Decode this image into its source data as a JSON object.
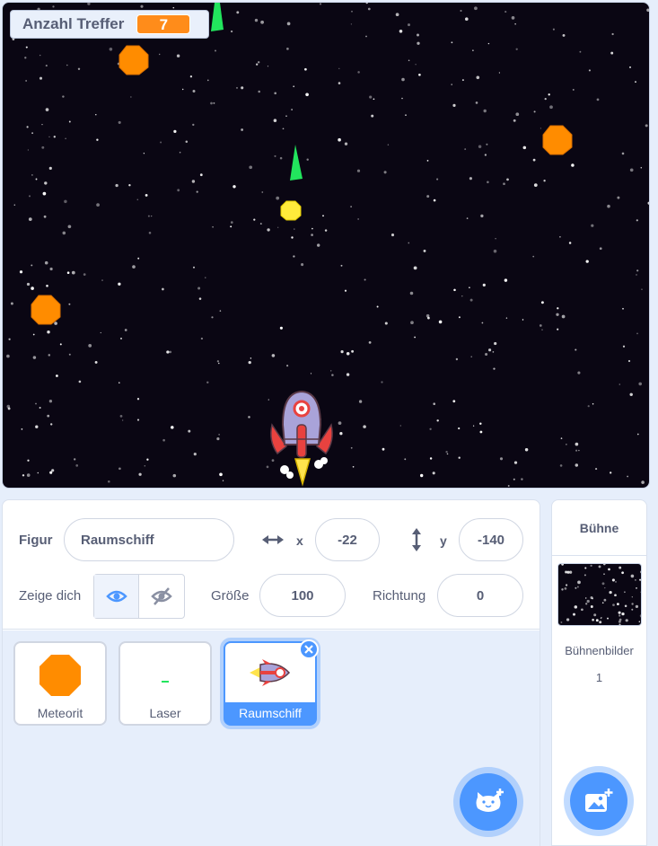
{
  "stage": {
    "monitor": {
      "label": "Anzahl Treffer",
      "value": "7"
    },
    "colors": {
      "background": "#0a0613",
      "meteor": "#ff8c00",
      "laser": "#22e55d",
      "coin": "#ffeb3b"
    }
  },
  "sprite_info": {
    "sprite_label": "Figur",
    "sprite_name": "Raumschiff",
    "x_label": "x",
    "x_value": "-22",
    "y_label": "y",
    "y_value": "-140",
    "show_label": "Zeige dich",
    "size_label": "Größe",
    "size_value": "100",
    "direction_label": "Richtung",
    "direction_value": "0"
  },
  "sprites": [
    {
      "name": "Meteorit",
      "icon": "meteor-icon",
      "selected": false
    },
    {
      "name": "Laser",
      "icon": "laser-icon",
      "selected": false
    },
    {
      "name": "Raumschiff",
      "icon": "rocket-icon",
      "selected": true
    }
  ],
  "stage_panel": {
    "title": "Bühne",
    "backdrops_label": "Bühnenbilder",
    "backdrops_count": "1"
  },
  "buttons": {
    "choose_sprite_icon": "cat-plus-icon",
    "choose_backdrop_icon": "image-plus-icon"
  }
}
